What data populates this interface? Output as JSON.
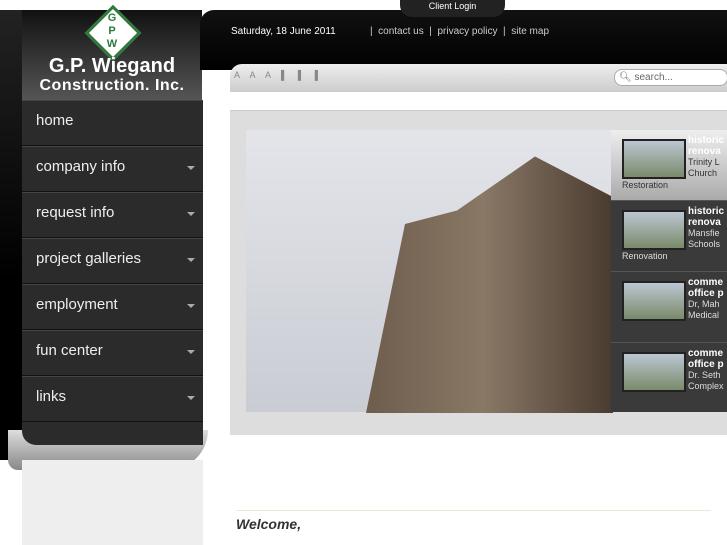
{
  "header": {
    "client_login": "Client Login",
    "date": "Saturday, 18 June 2011",
    "links": [
      "contact us",
      "privacy policy",
      "site map"
    ],
    "font_sizes": "A A A ▌ ▌ ▌",
    "search_placeholder": "search..."
  },
  "logo": {
    "letters": "G P W",
    "name_line1": "G.P. Wiegand",
    "name_line2": "Construction. Inc."
  },
  "nav": [
    {
      "label": "home"
    },
    {
      "label": "company info"
    },
    {
      "label": "request info"
    },
    {
      "label": "project galleries"
    },
    {
      "label": "employment"
    },
    {
      "label": "fun center"
    },
    {
      "label": "links"
    }
  ],
  "slider": {
    "items": [
      {
        "title1": "historic",
        "title2": "renova",
        "line1": "Trinity L",
        "line2": "Church",
        "caption": "Restoration"
      },
      {
        "title1": "historic",
        "title2": "renova",
        "line1": "Mansfie",
        "line2": "Schools",
        "caption": "Renovation"
      },
      {
        "title1": "comme",
        "title2": "office p",
        "line1": "Dr, Mah",
        "line2": "Medical",
        "caption": ""
      },
      {
        "title1": "comme",
        "title2": "office p",
        "line1": "Dr. Seth",
        "line2": "Complex",
        "caption": ""
      }
    ]
  },
  "main": {
    "welcome": "Welcome,"
  },
  "colors": {
    "brand_green": "#2d7a3a"
  }
}
